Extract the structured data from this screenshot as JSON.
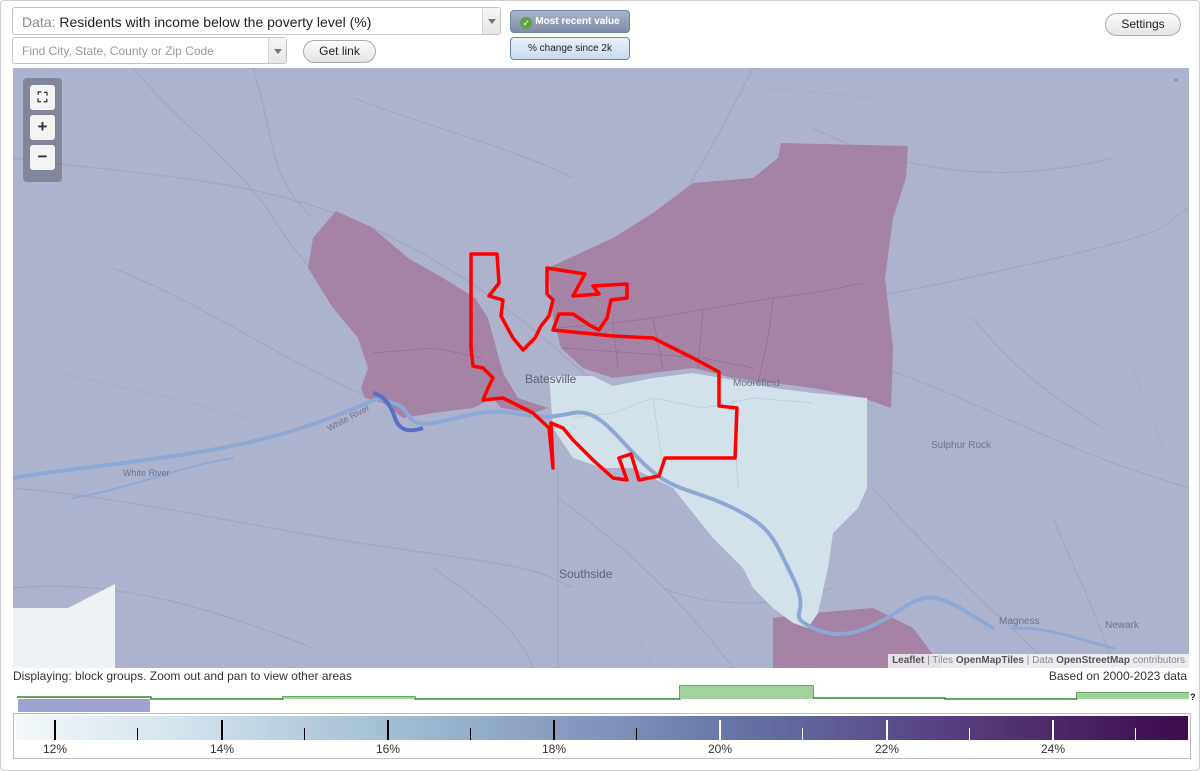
{
  "controls": {
    "data_prefix": "Data:",
    "data_value": "Residents with income below the poverty level (%)",
    "search_placeholder": "Find City, State, County or Zip Code",
    "get_link": "Get link",
    "most_recent": "Most recent value",
    "change_since": "% change since 2k",
    "settings": "Settings"
  },
  "map": {
    "zoom_in": "+",
    "zoom_out": "−",
    "full_extent": "⛶",
    "places": [
      "Batesville",
      "Moorefield",
      "Sulphur Rock",
      "Southside",
      "Magness",
      "Newark",
      "White River",
      "White River"
    ],
    "attribution": {
      "leaflet": "Leaflet",
      "tiles_label": "Tiles",
      "tiles": "OpenMapTiles",
      "data_label": "Data",
      "data": "OpenStreetMap",
      "contributors": "contributors"
    }
  },
  "footer": {
    "displaying": "Displaying: block groups. Zoom out and pan to view other areas",
    "based_on": "Based on 2000-2023 data",
    "help": "?"
  },
  "legend": {
    "labels": [
      "12%",
      "14%",
      "16%",
      "18%",
      "20%",
      "22%",
      "24%"
    ]
  },
  "colors": {
    "high_poverty_fill": "#a583a5",
    "low_poverty_fill": "#d3e1ea",
    "baseline_fill": "#aeb3cd",
    "city_boundary": "#ff0000",
    "river": "#8ea8d6"
  }
}
